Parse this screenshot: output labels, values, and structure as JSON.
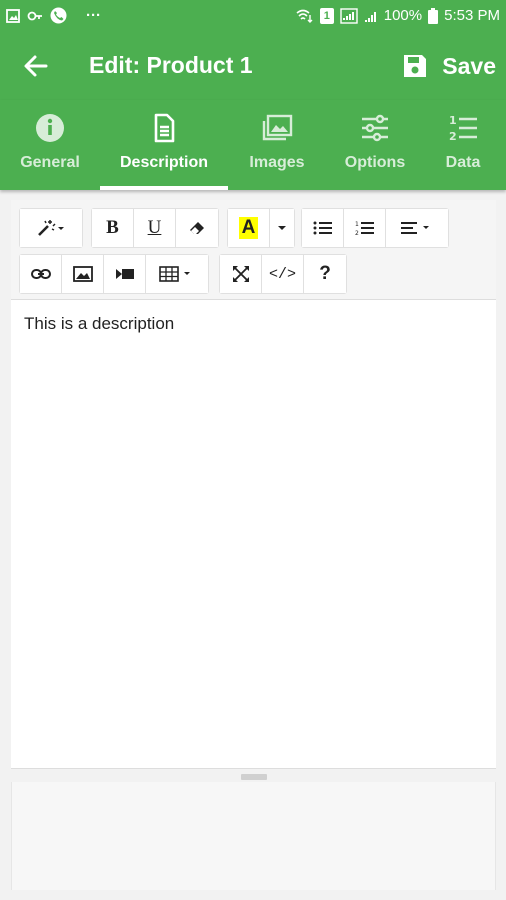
{
  "status_bar": {
    "battery": "100%",
    "time": "5:53 PM",
    "dots": "···",
    "sim": "1"
  },
  "appbar": {
    "title": "Edit: Product 1",
    "save_label": "Save"
  },
  "tabs": [
    {
      "label": "General",
      "icon": "info-icon"
    },
    {
      "label": "Description",
      "icon": "document-icon",
      "active": true
    },
    {
      "label": "Images",
      "icon": "images-icon"
    },
    {
      "label": "Options",
      "icon": "sliders-icon"
    },
    {
      "label": "Data",
      "icon": "numbered-list-icon"
    }
  ],
  "toolbar": {
    "bold": "B",
    "underline": "U",
    "color": "A",
    "code": "</>",
    "help": "?"
  },
  "editor": {
    "content": "This is a description"
  },
  "colors": {
    "primary": "#4caf50",
    "highlight": "#ffff00"
  }
}
